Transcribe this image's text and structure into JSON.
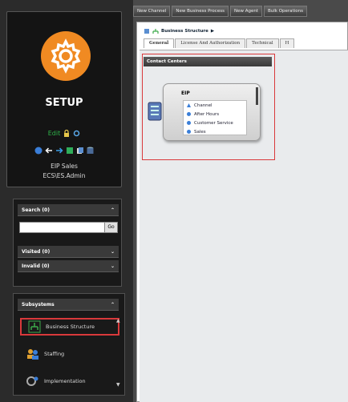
{
  "sidebar": {
    "title": "SETUP",
    "edit_label": "Edit",
    "user_line1": "EIP Sales",
    "user_line2": "ECS\\ES.Admin",
    "search_header": "Search (0)",
    "go_label": "Go",
    "visited_header": "Visited (0)",
    "invalid_header": "Invalid (0)",
    "subsystems_header": "Subsystems",
    "subsystems": [
      {
        "label": "Business Structure",
        "icon": "hierarchy-icon"
      },
      {
        "label": "Staffing",
        "icon": "people-icon"
      },
      {
        "label": "Implementation",
        "icon": "gear-people-icon"
      }
    ]
  },
  "toolbar": {
    "buttons": [
      "New Channel",
      "New Business Process",
      "New Agent",
      "Bulk Operations"
    ]
  },
  "main": {
    "breadcrumb": "Business Structure",
    "tabs": [
      "General",
      "License And Authorization",
      "Technical",
      "H"
    ],
    "section_header": "Contact Centers",
    "card": {
      "title": "EIP",
      "items": [
        "Channel",
        "After Hours",
        "Customer Service",
        "Sales"
      ]
    }
  },
  "colors": {
    "accent_orange": "#f08a22",
    "highlight_red": "#d9393b",
    "edit_green": "#2fb44a"
  }
}
